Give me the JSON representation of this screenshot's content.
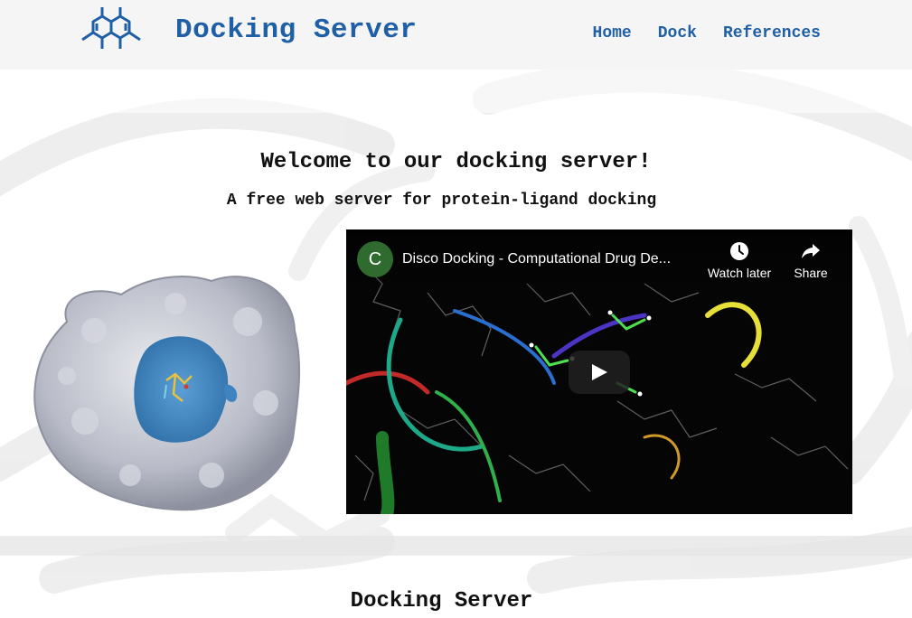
{
  "header": {
    "brand": "Docking Server",
    "nav": [
      {
        "label": "Home"
      },
      {
        "label": "Dock"
      },
      {
        "label": "References"
      }
    ]
  },
  "hero": {
    "title": "Welcome to our docking server!",
    "subtitle": "A free web server for protein-ligand docking"
  },
  "video": {
    "channel_initial": "C",
    "title": "Disco Docking - Computational Drug De...",
    "watch_later_label": "Watch later",
    "share_label": "Share"
  },
  "section": {
    "title": "Docking Server"
  },
  "colors": {
    "brand_blue": "#1f5fa6",
    "header_bg": "#f5f5f5",
    "avatar_green": "#2f6b2f"
  }
}
